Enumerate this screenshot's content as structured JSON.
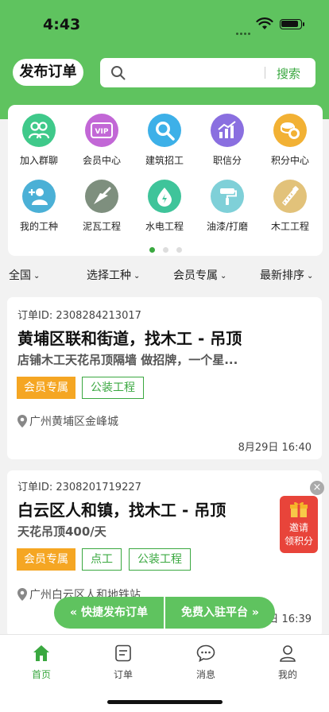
{
  "status_bar": {
    "time": "4:43"
  },
  "header": {
    "publish_label": "发布订单",
    "search_placeholder": "",
    "search_button": "搜索"
  },
  "grid": {
    "items": [
      {
        "label": "加入群聊",
        "icon": "group-icon",
        "color": "#3fc98a"
      },
      {
        "label": "会员中心",
        "icon": "vip-icon",
        "color": "#c267d6"
      },
      {
        "label": "建筑招工",
        "icon": "recruit-search-icon",
        "color": "#3db0e8"
      },
      {
        "label": "职信分",
        "icon": "chart-icon",
        "color": "#8a6fe0"
      },
      {
        "label": "积分中心",
        "icon": "coins-icon",
        "color": "#f2b134"
      },
      {
        "label": "我的工种",
        "icon": "add-user-icon",
        "color": "#4bb0d6"
      },
      {
        "label": "泥瓦工程",
        "icon": "trowel-icon",
        "color": "#7e8f7e"
      },
      {
        "label": "水电工程",
        "icon": "water-electric-icon",
        "color": "#3fc49a"
      },
      {
        "label": "油漆/打磨",
        "icon": "paint-roller-icon",
        "color": "#7fd0d8"
      },
      {
        "label": "木工工程",
        "icon": "saw-icon",
        "color": "#e2c27a"
      }
    ],
    "page_count": 3,
    "active_page": 1
  },
  "filters": {
    "region": "全国",
    "trade": "选择工种",
    "vip": "会员专属",
    "sort": "最新排序"
  },
  "orders": [
    {
      "id": "订单ID: 2308284213017",
      "title": "黄埔区联和街道，找木工 - 吊顶",
      "desc": "店铺木工天花吊顶隔墙 做招牌，一个星...",
      "tags": [
        "会员专属",
        "公装工程"
      ],
      "location": "广州黄埔区金峰城",
      "time": "8月29日 16:40"
    },
    {
      "id": "订单ID: 2308201719227",
      "title": "白云区人和镇，找木工 - 吊顶",
      "desc": "天花吊顶400/天",
      "tags": [
        "会员专属",
        "点工",
        "公装工程"
      ],
      "location": "广州白云区人和地铁站",
      "time": "8月29日 16:39"
    }
  ],
  "invite": {
    "line1": "邀请",
    "line2": "领积分"
  },
  "fab": {
    "left": "« 快捷发布订单",
    "right": "免费入驻平台 »"
  },
  "tabbar": [
    {
      "label": "首页",
      "icon": "home-icon"
    },
    {
      "label": "订单",
      "icon": "order-icon"
    },
    {
      "label": "消息",
      "icon": "message-icon"
    },
    {
      "label": "我的",
      "icon": "profile-icon"
    }
  ],
  "colors": {
    "brand_green": "#5fc35f",
    "accent_green": "#3aa840",
    "vip_orange": "#f5a623",
    "invite_red": "#e8443a"
  }
}
